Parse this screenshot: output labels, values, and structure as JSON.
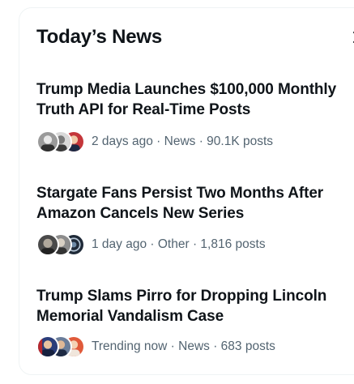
{
  "header": {
    "title": "Today’s News",
    "close_icon": "close-icon"
  },
  "news": [
    {
      "headline": "Trump Media Launches $100,000 Monthly Truth API for Real-Time Posts",
      "time": "2 days ago",
      "category": "News",
      "posts": "90.1K posts"
    },
    {
      "headline": "Stargate Fans Persist Two Months After Amazon Cancels New Series",
      "time": "1 day ago",
      "category": "Other",
      "posts": "1,816 posts"
    },
    {
      "headline": "Trump Slams Pirro for Dropping Lincoln Memorial Vandalism Case",
      "time": "Trending now",
      "category": "News",
      "posts": "683 posts"
    }
  ],
  "separator": " · ",
  "colors": {
    "text_primary": "#0f1419",
    "text_secondary": "#536471",
    "border": "#eff3f4"
  }
}
